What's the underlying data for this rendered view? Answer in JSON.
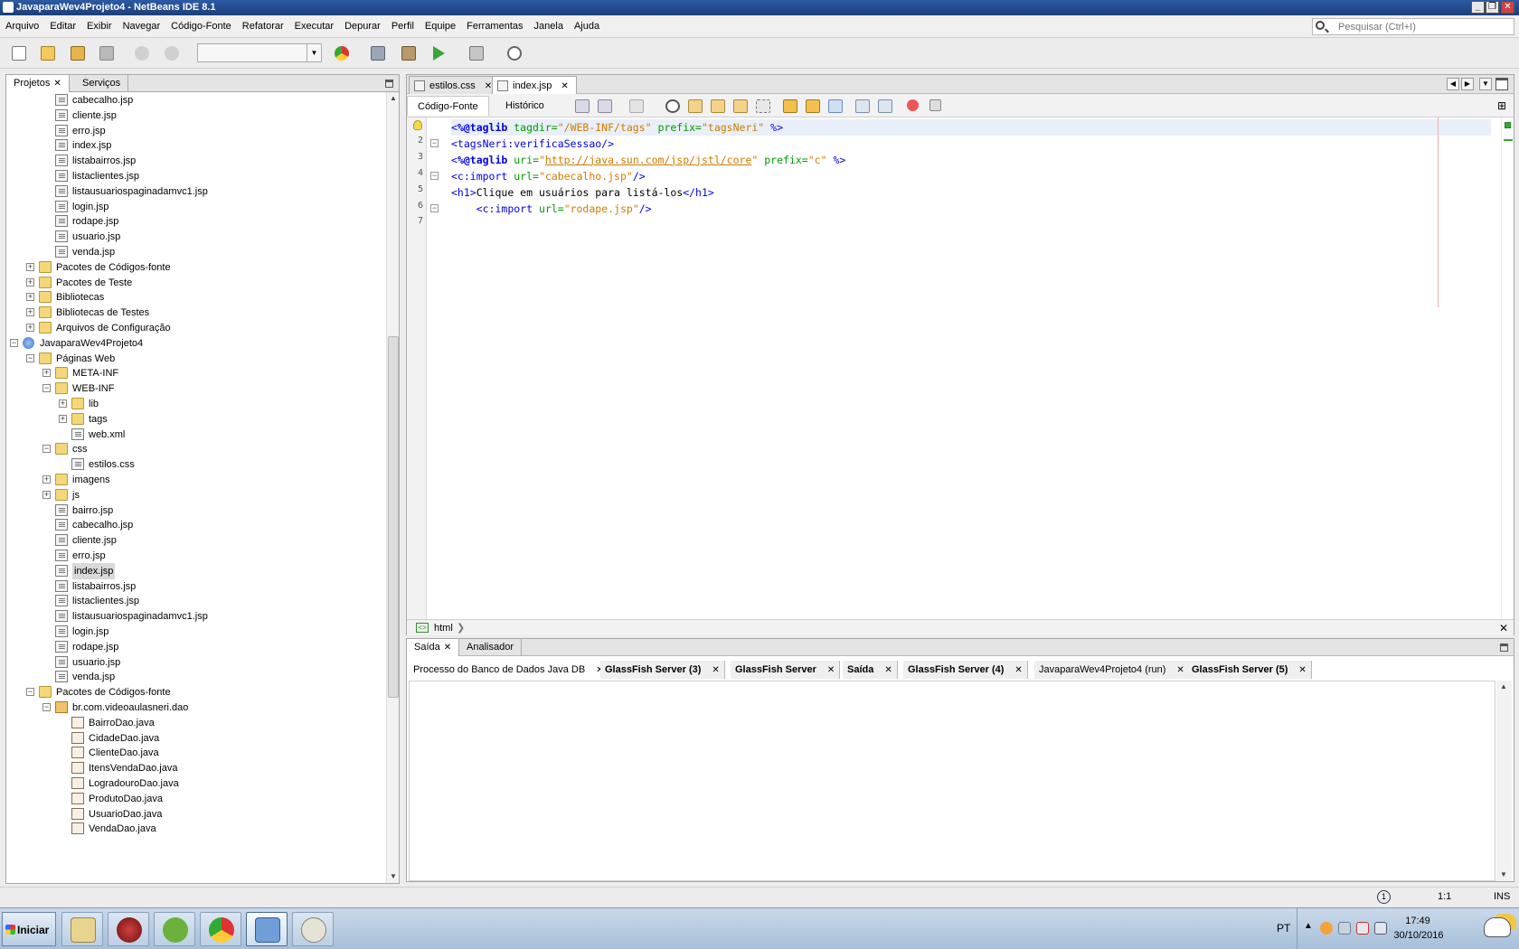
{
  "window": {
    "title": "JavaparaWev4Projeto4 - NetBeans IDE 8.1",
    "controls": {
      "minimize": "_",
      "maximize": "❐",
      "close": "✕"
    }
  },
  "menu": {
    "items": [
      "Arquivo",
      "Editar",
      "Exibir",
      "Navegar",
      "Código-Fonte",
      "Refatorar",
      "Executar",
      "Depurar",
      "Perfil",
      "Equipe",
      "Ferramentas",
      "Janela",
      "Ajuda"
    ],
    "search_placeholder": "Pesquisar (Ctrl+I)"
  },
  "toolbar": {
    "icons": [
      "new-file-icon",
      "new-project-icon",
      "open-project-icon",
      "close-project-icon",
      "undo-icon",
      "redo-icon",
      "chrome-browser-icon",
      "build-hammer-icon",
      "clean-build-icon",
      "run-icon",
      "debug-icon",
      "profile-icon"
    ],
    "config_value": ""
  },
  "left_panel": {
    "tabs": [
      {
        "label": "Projetos",
        "active": true
      },
      {
        "label": "Serviços",
        "active": false
      }
    ],
    "tree": [
      {
        "label": "cabecalho.jsp",
        "icon": "file",
        "level": 3
      },
      {
        "label": "cliente.jsp",
        "icon": "file",
        "level": 3
      },
      {
        "label": "erro.jsp",
        "icon": "file",
        "level": 3
      },
      {
        "label": "index.jsp",
        "icon": "file",
        "level": 3
      },
      {
        "label": "listabairros.jsp",
        "icon": "file",
        "level": 3
      },
      {
        "label": "listaclientes.jsp",
        "icon": "file",
        "level": 3
      },
      {
        "label": "listausuariospaginadamvc1.jsp",
        "icon": "file",
        "level": 3
      },
      {
        "label": "login.jsp",
        "icon": "file",
        "level": 3
      },
      {
        "label": "rodape.jsp",
        "icon": "file",
        "level": 3
      },
      {
        "label": "usuario.jsp",
        "icon": "file",
        "level": 3
      },
      {
        "label": "venda.jsp",
        "icon": "file",
        "level": 3
      },
      {
        "label": "Pacotes de Códigos-fonte",
        "icon": "folder",
        "level": 2,
        "toggle": "+"
      },
      {
        "label": "Pacotes de Teste",
        "icon": "folder",
        "level": 2,
        "toggle": "+"
      },
      {
        "label": "Bibliotecas",
        "icon": "folder",
        "level": 2,
        "toggle": "+"
      },
      {
        "label": "Bibliotecas de Testes",
        "icon": "folder",
        "level": 2,
        "toggle": "+"
      },
      {
        "label": "Arquivos de Configuração",
        "icon": "folder",
        "level": 2,
        "toggle": "+"
      },
      {
        "label": "JavaparaWev4Projeto4",
        "icon": "web",
        "level": 1,
        "toggle": "-"
      },
      {
        "label": "Páginas Web",
        "icon": "folder",
        "level": 2,
        "toggle": "-"
      },
      {
        "label": "META-INF",
        "icon": "folder",
        "level": 3,
        "toggle": "+"
      },
      {
        "label": "WEB-INF",
        "icon": "folder",
        "level": 3,
        "toggle": "-"
      },
      {
        "label": "lib",
        "icon": "folder",
        "level": 4,
        "toggle": "+"
      },
      {
        "label": "tags",
        "icon": "folder",
        "level": 4,
        "toggle": "+"
      },
      {
        "label": "web.xml",
        "icon": "file",
        "level": 4
      },
      {
        "label": "css",
        "icon": "folder",
        "level": 3,
        "toggle": "-"
      },
      {
        "label": "estilos.css",
        "icon": "file",
        "level": 4
      },
      {
        "label": "imagens",
        "icon": "folder",
        "level": 3,
        "toggle": "+"
      },
      {
        "label": "js",
        "icon": "folder",
        "level": 3,
        "toggle": "+"
      },
      {
        "label": "bairro.jsp",
        "icon": "file",
        "level": 3
      },
      {
        "label": "cabecalho.jsp",
        "icon": "file",
        "level": 3
      },
      {
        "label": "cliente.jsp",
        "icon": "file",
        "level": 3
      },
      {
        "label": "erro.jsp",
        "icon": "file",
        "level": 3
      },
      {
        "label": "index.jsp",
        "icon": "file",
        "level": 3,
        "selected": true
      },
      {
        "label": "listabairros.jsp",
        "icon": "file",
        "level": 3
      },
      {
        "label": "listaclientes.jsp",
        "icon": "file",
        "level": 3
      },
      {
        "label": "listausuariospaginadamvc1.jsp",
        "icon": "file",
        "level": 3
      },
      {
        "label": "login.jsp",
        "icon": "file",
        "level": 3
      },
      {
        "label": "rodape.jsp",
        "icon": "file",
        "level": 3
      },
      {
        "label": "usuario.jsp",
        "icon": "file",
        "level": 3
      },
      {
        "label": "venda.jsp",
        "icon": "file",
        "level": 3
      },
      {
        "label": "Pacotes de Códigos-fonte",
        "icon": "folder",
        "level": 2,
        "toggle": "-"
      },
      {
        "label": "br.com.videoaulasneri.dao",
        "icon": "pkg",
        "level": 3,
        "toggle": "-"
      },
      {
        "label": "BairroDao.java",
        "icon": "java",
        "level": 4
      },
      {
        "label": "CidadeDao.java",
        "icon": "java",
        "level": 4
      },
      {
        "label": "ClienteDao.java",
        "icon": "java",
        "level": 4
      },
      {
        "label": "ItensVendaDao.java",
        "icon": "java",
        "level": 4
      },
      {
        "label": "LogradouroDao.java",
        "icon": "java",
        "level": 4
      },
      {
        "label": "ProdutoDao.java",
        "icon": "java",
        "level": 4
      },
      {
        "label": "UsuarioDao.java",
        "icon": "java",
        "level": 4
      },
      {
        "label": "VendaDao.java",
        "icon": "java",
        "level": 4
      }
    ]
  },
  "editor": {
    "tabs": [
      {
        "label": "estilos.css",
        "active": false
      },
      {
        "label": "index.jsp",
        "active": true
      }
    ],
    "subtabs": [
      {
        "label": "Código-Fonte",
        "active": true
      },
      {
        "label": "Histórico",
        "active": false
      }
    ],
    "lines": [
      {
        "n": "1",
        "fold": "",
        "tokens": [
          [
            "t-tag",
            "<"
          ],
          [
            "t-dir",
            "%@taglib "
          ],
          [
            "t-attr",
            "tagdir="
          ],
          [
            "t-str",
            "\"/WEB-INF/tags\""
          ],
          [
            "t-text",
            " "
          ],
          [
            "t-attr",
            "prefix="
          ],
          [
            "t-str",
            "\"tagsNeri\""
          ],
          [
            "t-text",
            " "
          ],
          [
            "t-tag",
            "%>"
          ]
        ]
      },
      {
        "n": "2",
        "fold": "-",
        "tokens": [
          [
            "t-tag",
            "<tagsNeri:verificaSessao/>"
          ]
        ]
      },
      {
        "n": "3",
        "fold": "",
        "tokens": [
          [
            "t-tag",
            "<"
          ],
          [
            "t-dir",
            "%@taglib "
          ],
          [
            "t-attr",
            "uri="
          ],
          [
            "t-str",
            "\""
          ],
          [
            "t-link",
            "http://java.sun.com/jsp/jstl/core"
          ],
          [
            "t-str",
            "\""
          ],
          [
            "t-text",
            " "
          ],
          [
            "t-attr",
            "prefix="
          ],
          [
            "t-str",
            "\"c\""
          ],
          [
            "t-text",
            " "
          ],
          [
            "t-tag",
            "%>"
          ]
        ]
      },
      {
        "n": "4",
        "fold": "-",
        "tokens": [
          [
            "t-tag",
            "<c:import "
          ],
          [
            "t-attr",
            "url="
          ],
          [
            "t-str",
            "\"cabecalho.jsp\""
          ],
          [
            "t-tag",
            "/>"
          ]
        ]
      },
      {
        "n": "5",
        "fold": "",
        "tokens": [
          [
            "t-tag",
            "<h1>"
          ],
          [
            "t-text",
            "Clique em usuários para listá-los"
          ],
          [
            "t-tag",
            "</h1>"
          ]
        ]
      },
      {
        "n": "6",
        "fold": "-",
        "tokens": [
          [
            "t-text",
            "    "
          ],
          [
            "t-tag",
            "<c:import "
          ],
          [
            "t-attr",
            "url="
          ],
          [
            "t-str",
            "\"rodape.jsp\""
          ],
          [
            "t-tag",
            "/>"
          ]
        ]
      },
      {
        "n": "7",
        "fold": "",
        "tokens": []
      }
    ],
    "breadcrumb": "html"
  },
  "output": {
    "tabs": [
      {
        "label": "Saída",
        "active": true
      },
      {
        "label": "Analisador",
        "active": false
      }
    ],
    "subtabs": [
      {
        "label": "Processo do Banco de Dados Java DB",
        "bold": false,
        "active": true
      },
      {
        "label": "GlassFish Server (3)",
        "bold": true
      },
      {
        "label": "GlassFish Server",
        "bold": true
      },
      {
        "label": "Saída",
        "bold": true
      },
      {
        "label": "GlassFish Server (4)",
        "bold": true
      },
      {
        "label": "JavaparaWev4Projeto4 (run)",
        "bold": false
      },
      {
        "label": "GlassFish Server (5)",
        "bold": true
      }
    ]
  },
  "statusbar": {
    "notification_count": "1",
    "position": "1:1",
    "mode": "INS"
  },
  "taskbar": {
    "start_label": "Iniciar",
    "apps": [
      "file-manager-icon",
      "media-player-icon",
      "utorrent-icon",
      "chrome-icon",
      "netbeans-icon",
      "paint-icon"
    ],
    "language": "PT",
    "time": "17:49",
    "date": "30/10/2016"
  }
}
